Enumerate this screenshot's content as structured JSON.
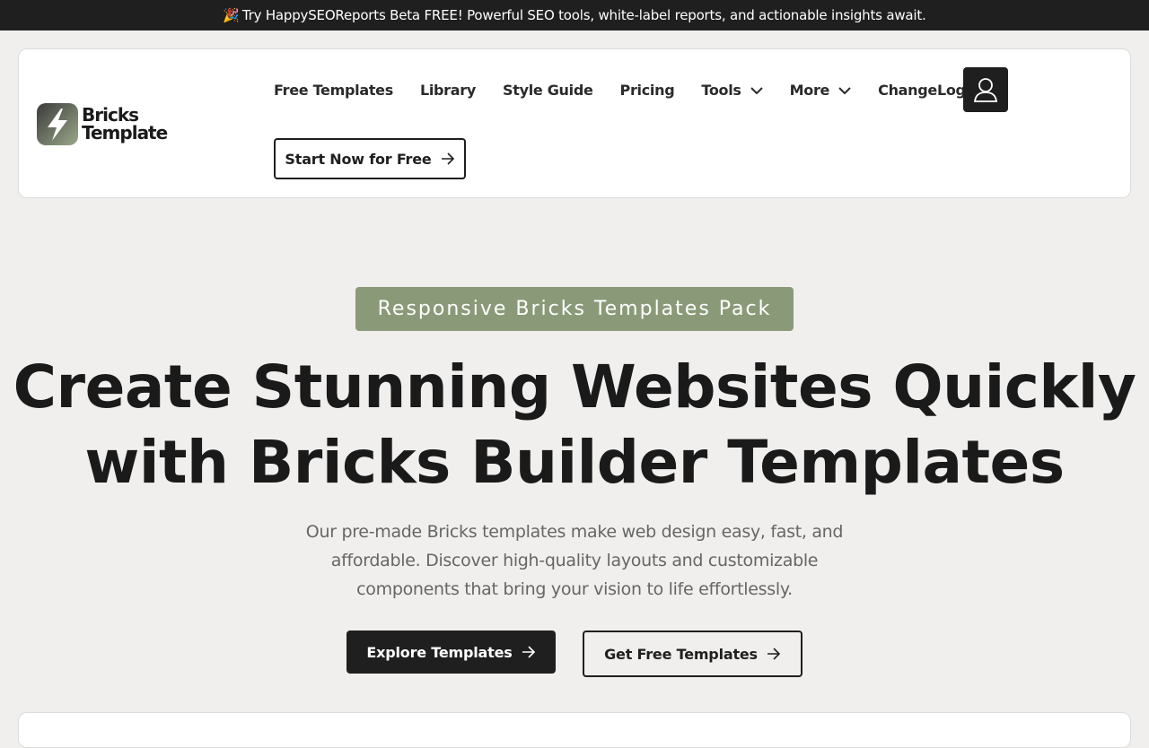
{
  "announcement": {
    "emoji": "🎉",
    "text": "Try HappySEOReports Beta FREE! Powerful SEO tools, white-label reports, and actionable insights await."
  },
  "logo": {
    "line1": "Bricks",
    "line2": "Template"
  },
  "nav": {
    "items": [
      {
        "label": "Free Templates",
        "dropdown": false
      },
      {
        "label": "Library",
        "dropdown": false
      },
      {
        "label": "Style Guide",
        "dropdown": false
      },
      {
        "label": "Pricing",
        "dropdown": false
      },
      {
        "label": "Tools",
        "dropdown": true
      },
      {
        "label": "More",
        "dropdown": true
      },
      {
        "label": "ChangeLog",
        "dropdown": false
      }
    ],
    "cta_label": "Start Now for Free"
  },
  "hero": {
    "badge": "Responsive Bricks Templates Pack",
    "headline_line1": "Create Stunning Websites Quickly",
    "headline_line2": "with Bricks Builder Templates",
    "sub_line1": "Our pre-made Bricks templates make web design easy, fast, and",
    "sub_line2": "affordable. Discover high-quality layouts and customizable",
    "sub_line3": "components that bring your vision to life effortlessly.",
    "primary_button": "Explore Templates",
    "secondary_button": "Get Free Templates"
  },
  "colors": {
    "dark": "#1f1f1f",
    "accent": "#8a9a78",
    "background": "#f0efed"
  }
}
